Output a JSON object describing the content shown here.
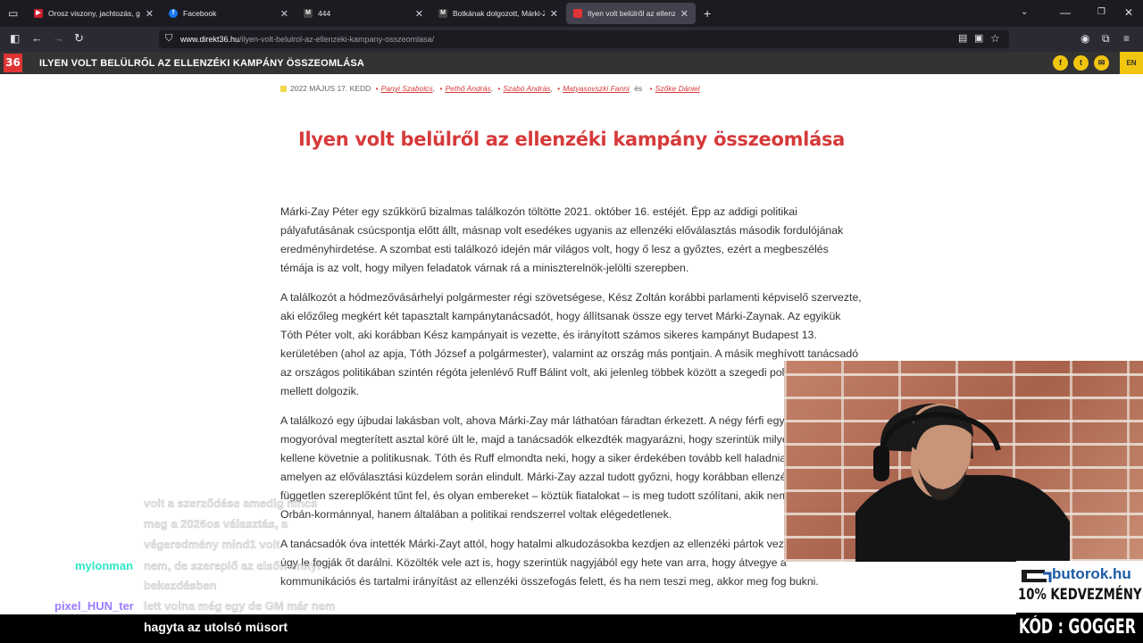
{
  "browser": {
    "tabs": [
      {
        "title": "Orosz viszony, jachtozás, gyűlölet",
        "favicon_color": "#cc1f2d",
        "active": false
      },
      {
        "title": "Facebook",
        "favicon_color": "#1877f2",
        "active": false
      },
      {
        "title": "444",
        "favicon_color": "#222222",
        "active": false
      },
      {
        "title": "Botkának dolgozott, Márki-Zay",
        "favicon_color": "#222222",
        "active": false
      },
      {
        "title": "Ilyen volt belülről az ellenzéki k",
        "favicon_color": "#e03434",
        "active": true
      }
    ],
    "url_host": "www.direkt36.hu",
    "url_path": "/ilyen-volt-belulrol-az-ellenzeki-kampany-osszeomlasa/"
  },
  "site": {
    "logo": "36",
    "header_title": "ILYEN VOLT BELÜLRŐL AZ ELLENZÉKI KAMPÁNY ÖSSZEOMLÁSA",
    "lang_button": "EN",
    "accent": "#f1c40f",
    "brand_red": "#d63a3a"
  },
  "article": {
    "date": "2022 MÁJUS 17. KEDD",
    "authors": [
      "Panyi Szabolcs",
      "Pethő András",
      "Szabó András",
      "Matyasovszki Fanni"
    ],
    "author_and": "és",
    "last_author": "Szőke Dániel",
    "headline": "Ilyen volt belülről az ellenzéki kampány összeomlása",
    "paragraphs": [
      "Márki-Zay Péter egy szűkkörű bizalmas találkozón töltötte 2021. október 16. estéjét. Épp az addigi politikai pályafutásának csúcspontja előtt állt, másnap volt esedékes ugyanis az ellenzéki előválasztás második fordulójának eredményhirdetése. A szombat esti találkozó idején már világos volt, hogy ő lesz a győztes, ezért a megbeszélés témája is az volt, hogy milyen feladatok várnak rá a miniszterelnök-jelölti szerepben.",
      "A találkozót a hódmezővásárhelyi polgármester régi szövetségese, Kész Zoltán korábbi parlamenti képviselő szervezte, aki előzőleg megkért két tapasztalt kampánytanácsadót, hogy állítsanak össze egy tervet Márki-Zaynak. Az egyikük Tóth Péter volt, aki korábban Kész kampányait is vezette, és irányított számos sikeres kampányt Budapest 13. kerületében (ahol az apja, Tóth József a polgármester), valamint az ország más pontjain. A másik meghívott tanácsadó az országos politikában szintén régóta jelenlévő Ruff Bálint volt, aki jelenleg többek között a szegedi polgármester mellett dolgozik.",
      "A találkozó egy újbudai lakásban volt, ahova Márki-Zay már láthatóan fáradtan érkezett. A négy férfi egy és egy tál mogyoróval megterített asztal köré ült le, majd a tanácsadók elkezdték magyarázni, hogy szerintük milyen stratégiát kellene követnie a politikusnak. Tóth és Ruff elmondta neki, hogy a siker érdekében tovább kell haladnia azon az úton, amelyen az előválasztási küzdelem során elindult. Márki-Zay azzal tudott győzni, hogy korábban ellenzéki pártoktól független szereplőként tűnt fel, és olyan embereket – köztük fiatalokat – is meg tudott szólítani, akik nemcsak az Orbán-kormánnyal, hanem általában a politikai rendszerrel voltak elégedetlenek.",
      "A tanácsadók óva intették Márki-Zayt attól, hogy hatalmi alkudozásokba kezdjen az ellenzéki pártok vezetőivel, mert úgy le fogják őt darálni. Közölték vele azt is, hogy szerintük nagyjából egy hete van arra, hogy átvegye a kommunikációs és tartalmi irányítást az ellenzéki összefogás felett, és ha nem teszi meg, akkor meg fog bukni."
    ]
  },
  "chat": [
    {
      "user": "",
      "text": "volt a szerződése amedig nincs",
      "user_color": "#b58cff"
    },
    {
      "user": "",
      "text": "meg a 2026os választás, a",
      "user_color": "#b58cff"
    },
    {
      "user": "",
      "text": "végeredmény mind1 volt",
      "user_color": "#b58cff"
    },
    {
      "user": "mylonman",
      "text": "nem, de szereplő az elsőn ennyi",
      "user_color": "#2ee6c8"
    },
    {
      "user": "",
      "text": "bekezdésben",
      "user_color": "#2ee6c8"
    },
    {
      "user": "pixel_HUN_ter",
      "text": "lett volna még egy de GM már nem",
      "user_color": "#9b7bff"
    }
  ],
  "caption": "hagyta az utolsó müsort",
  "sponsor": {
    "domain": "butorok.hu",
    "discount": "10% KEDVEZMÉNY",
    "code": "KÓD : GOGGER"
  }
}
